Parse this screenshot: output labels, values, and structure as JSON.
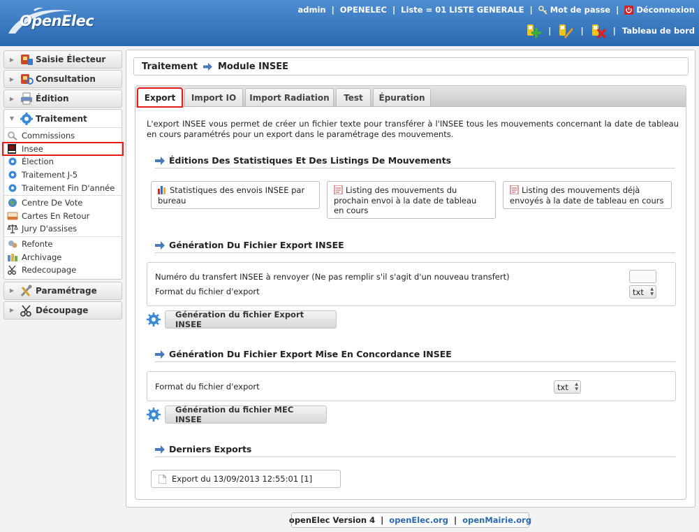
{
  "header": {
    "app_name": "OpenElec",
    "user": "admin",
    "collectivite": "OPENELEC",
    "liste": "Liste = 01 LISTE GENERALE",
    "password_link": "Mot de passe",
    "logout_link": "Déconnexion",
    "dashboard_link": "Tableau de bord",
    "separator": "|",
    "colors": {
      "band_top": "#4f8ed1",
      "band_bottom": "#2a68b0"
    }
  },
  "sidebar": {
    "menus": [
      {
        "label": "Saisie Électeur",
        "icon": "elector-icon"
      },
      {
        "label": "Consultation",
        "icon": "consultation-icon"
      },
      {
        "label": "Édition",
        "icon": "printer-icon"
      },
      {
        "label": "Traitement",
        "icon": "gear-icon",
        "open": true
      }
    ],
    "traitement_items": [
      {
        "label": "Commissions",
        "icon": "commission-icon"
      },
      {
        "label": "Insee",
        "icon": "insee-icon",
        "highlighted": true
      },
      {
        "label": "Élection",
        "icon": "gear-icon"
      },
      {
        "label": "Traitement J-5",
        "icon": "gear-icon"
      },
      {
        "label": "Traitement Fin D'année",
        "icon": "gear-icon"
      },
      {
        "label": "Centre De Vote",
        "icon": "globe-icon"
      },
      {
        "label": "Cartes En Retour",
        "icon": "card-icon"
      },
      {
        "label": "Jury D'assises",
        "icon": "scales-icon"
      },
      {
        "label": "Refonte",
        "icon": "refonte-icon"
      },
      {
        "label": "Archivage",
        "icon": "archive-icon"
      },
      {
        "label": "Redecoupage",
        "icon": "scissors-icon"
      }
    ],
    "bottom_menus": [
      {
        "label": "Paramétrage",
        "icon": "tools-icon"
      },
      {
        "label": "Découpage",
        "icon": "scissors-icon"
      }
    ]
  },
  "main": {
    "breadcrumb": {
      "parent": "Traitement",
      "current": "Module INSEE"
    },
    "tabs": [
      {
        "label": "Export",
        "active": true
      },
      {
        "label": "Import IO"
      },
      {
        "label": "Import Radiation"
      },
      {
        "label": "Test"
      },
      {
        "label": "Épuration"
      }
    ],
    "intro": "L'export INSEE vous permet de créer un fichier texte pour transférer à l'INSEE tous les mouvements concernant la date de tableau en cours paramétrés pour un export dans le paramétrage des mouvements.",
    "sections": {
      "editions": {
        "title": "Éditions Des Statistiques Et Des Listings De Mouvements",
        "links": [
          {
            "label": "Statistiques des envois INSEE par bureau",
            "icon": "stats-icon"
          },
          {
            "label": "Listing des mouvements du prochain envoi à la date de tableau en cours",
            "icon": "pdf-icon"
          },
          {
            "label": "Listing des mouvements déjà envoyés à la date de tableau en cours",
            "icon": "pdf-icon"
          }
        ]
      },
      "export": {
        "title": "Génération Du Fichier Export INSEE",
        "transfer_label": "Numéro du transfert INSEE à renvoyer (Ne pas remplir s'il s'agit d'un nouveau transfert)",
        "transfer_value": "",
        "format_label": "Format du fichier d'export",
        "format_value": "txt",
        "button": "Génération du fichier Export INSEE"
      },
      "mec": {
        "title": "Génération Du Fichier Export Mise En Concordance INSEE",
        "format_label": "Format du fichier d'export",
        "format_value": "txt",
        "button": "Génération du fichier MEC INSEE"
      },
      "last_exports": {
        "title": "Derniers Exports",
        "items": [
          "Export du 13/09/2013 12:55:01 [1]"
        ]
      }
    }
  },
  "footer": {
    "version": "openElec Version 4",
    "link1": "openElec.org",
    "link2": "openMairie.org"
  },
  "colors": {
    "highlight_red": "#e31c1c",
    "accent_blue": "#2a68b0"
  }
}
